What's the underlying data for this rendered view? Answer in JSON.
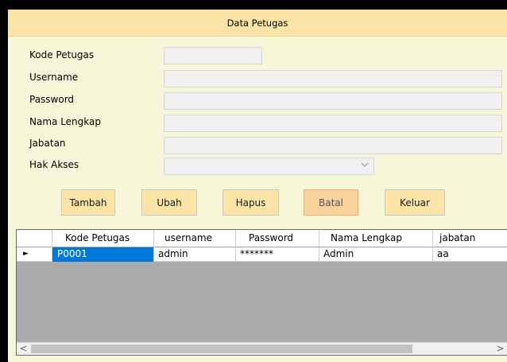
{
  "window": {
    "title": "Data Petugas"
  },
  "form": {
    "kode_petugas": {
      "label": "Kode Petugas",
      "value": ""
    },
    "username": {
      "label": "Username",
      "value": ""
    },
    "password": {
      "label": "Password",
      "value": ""
    },
    "nama_lengkap": {
      "label": "Nama Lengkap",
      "value": ""
    },
    "jabatan": {
      "label": "Jabatan",
      "value": ""
    },
    "hak_akses": {
      "label": "Hak Akses",
      "value": "",
      "arrow_icon": "chevron-down-icon"
    }
  },
  "buttons": {
    "tambah": "Tambah",
    "ubah": "Ubah",
    "hapus": "Hapus",
    "batal": "Batal",
    "keluar": "Keluar"
  },
  "grid": {
    "columns": [
      "Kode Petugas",
      "username",
      "Password",
      "Nama Lengkap",
      "jabatan"
    ],
    "rows": [
      {
        "kode_petugas": "P0001",
        "username": "admin",
        "password": "*******",
        "nama_lengkap": "Admin",
        "jabatan": "aa"
      }
    ],
    "current_row_indicator": "►",
    "scroll_left": "<",
    "scroll_right": ">"
  },
  "colors": {
    "form_background": "#f8f6d8",
    "title_bar": "#fbe4a6",
    "button": "#fbe4a6",
    "selected_cell": "#0078d7"
  }
}
